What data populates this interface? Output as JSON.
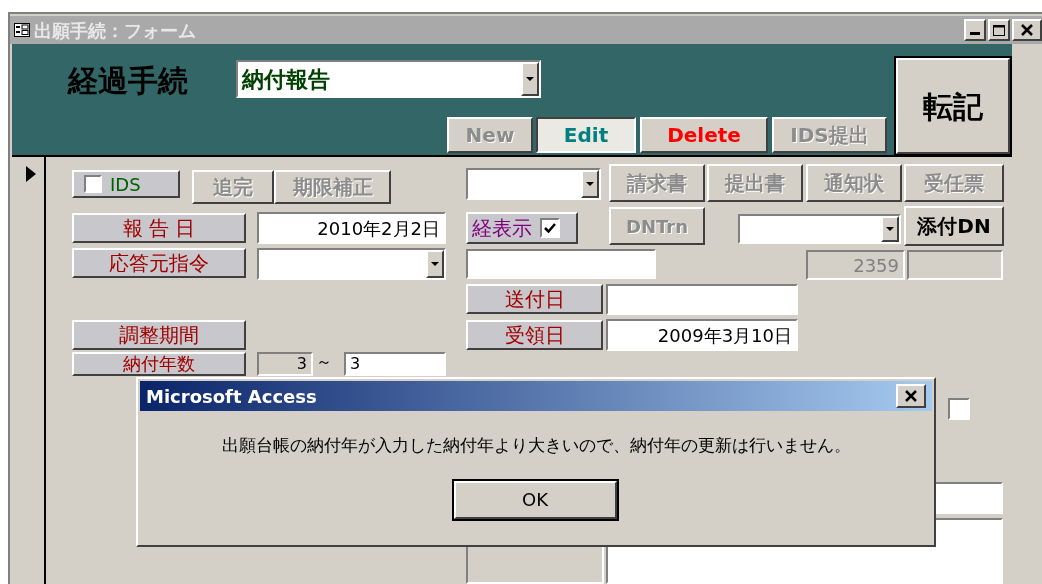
{
  "window": {
    "title": "出願手続：フォーム"
  },
  "header": {
    "label": "経過手続",
    "procedure": {
      "value": "納付報告"
    },
    "buttons": [
      {
        "label": "New",
        "kind": "disabled"
      },
      {
        "label": "Edit",
        "kind": "pressed"
      },
      {
        "label": "Delete",
        "kind": "danger"
      },
      {
        "label": "IDS提出",
        "kind": "disabled"
      }
    ],
    "transfer_button": {
      "label": "転記",
      "kind": "normal"
    }
  },
  "detail": {
    "ids_checkbox": {
      "label": "IDS",
      "checked": false
    },
    "left_buttons": [
      {
        "label": "追完",
        "kind": "disabled"
      },
      {
        "label": "期限補正",
        "kind": "disabled"
      }
    ],
    "report_date": {
      "label": "報 告 日",
      "value": "2010年2月2日"
    },
    "response_source": {
      "label": "応答元指令"
    },
    "adjustment_period": {
      "label": "調整期間"
    },
    "payment_years": {
      "label": "納付年数",
      "from": "3",
      "separator": "～",
      "to": "3"
    },
    "document_buttons": [
      {
        "label": "請求書",
        "kind": "disabled"
      },
      {
        "label": "提出書",
        "kind": "disabled"
      },
      {
        "label": "通知状",
        "kind": "disabled"
      },
      {
        "label": "受任票",
        "kind": "disabled"
      }
    ],
    "show_checkbox": {
      "label": "経表示",
      "checked": true
    },
    "dntrn_button": {
      "label": "DNTrn",
      "kind": "disabled"
    },
    "attach_button": {
      "label": "添付DN",
      "kind": "normal"
    },
    "number_field": {
      "value": "2359"
    },
    "send_date": {
      "label": "送付日"
    },
    "receipt_date": {
      "label": "受領日",
      "value": "2009年3月10日"
    },
    "extra_checkbox": {
      "checked": false
    }
  },
  "dialog": {
    "title": "Microsoft Access",
    "message": "出願台帳の納付年が入力した納付年より大きいので、納付年の更新は行いません。",
    "button": "OK"
  }
}
